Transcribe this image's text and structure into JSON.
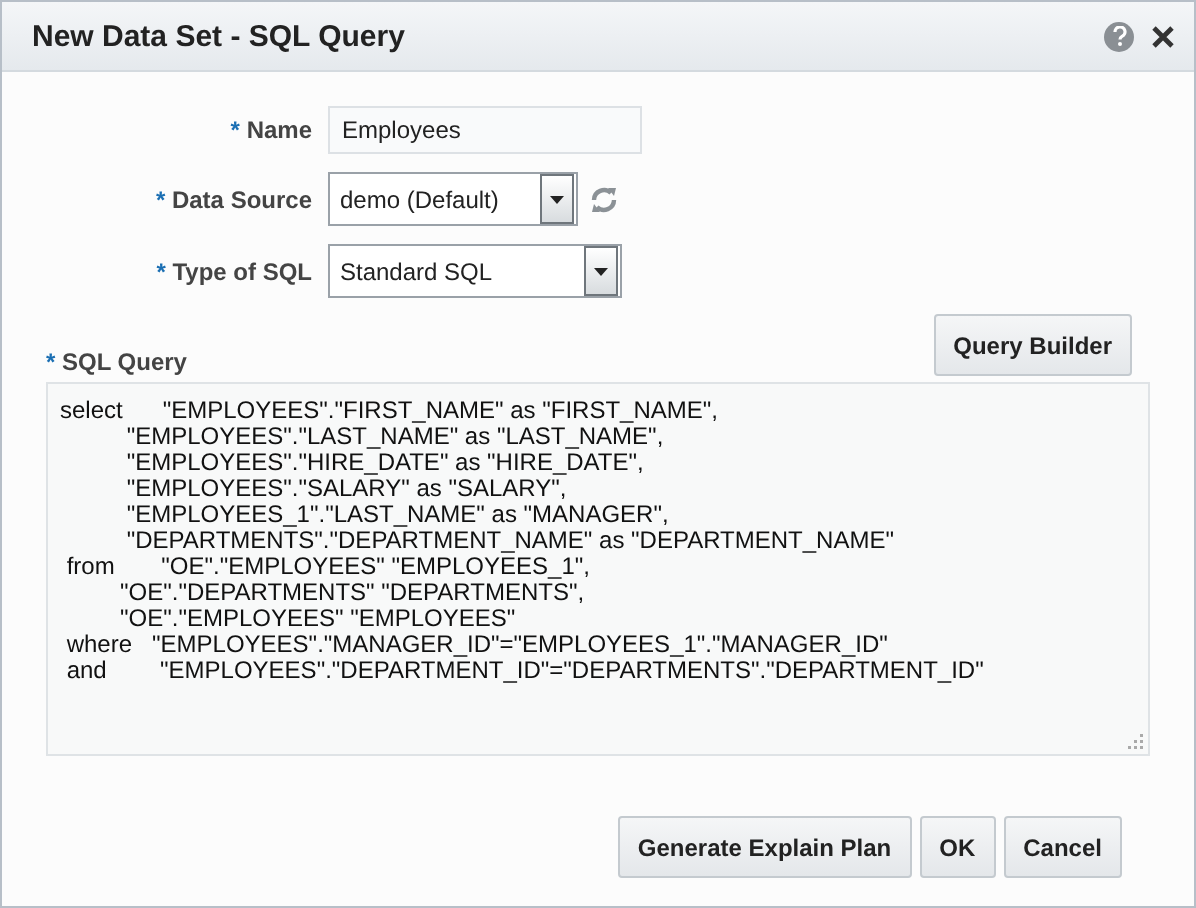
{
  "window": {
    "title": "New Data Set - SQL Query"
  },
  "fields": [
    {
      "kind": "text",
      "required_mark": "*",
      "label": "Name",
      "value": "Employees"
    },
    {
      "kind": "select",
      "required_mark": "*",
      "label": "Data Source",
      "value": "demo (Default)",
      "refresh": true
    },
    {
      "kind": "select",
      "required_mark": "*",
      "label": "Type of SQL",
      "value": "Standard SQL",
      "refresh": false
    }
  ],
  "query": {
    "required_mark": "*",
    "label": "SQL Query",
    "builder_button": "Query Builder",
    "text": "select      \"EMPLOYEES\".\"FIRST_NAME\" as \"FIRST_NAME\",\n          \"EMPLOYEES\".\"LAST_NAME\" as \"LAST_NAME\",\n          \"EMPLOYEES\".\"HIRE_DATE\" as \"HIRE_DATE\",\n          \"EMPLOYEES\".\"SALARY\" as \"SALARY\",\n          \"EMPLOYEES_1\".\"LAST_NAME\" as \"MANAGER\",\n          \"DEPARTMENTS\".\"DEPARTMENT_NAME\" as \"DEPARTMENT_NAME\"\n from       \"OE\".\"EMPLOYEES\" \"EMPLOYEES_1\",\n         \"OE\".\"DEPARTMENTS\" \"DEPARTMENTS\",\n         \"OE\".\"EMPLOYEES\" \"EMPLOYEES\"\n where   \"EMPLOYEES\".\"MANAGER_ID\"=\"EMPLOYEES_1\".\"MANAGER_ID\"\n and        \"EMPLOYEES\".\"DEPARTMENT_ID\"=\"DEPARTMENTS\".\"DEPARTMENT_ID\""
  },
  "buttons": [
    "Generate Explain Plan",
    "OK",
    "Cancel"
  ]
}
